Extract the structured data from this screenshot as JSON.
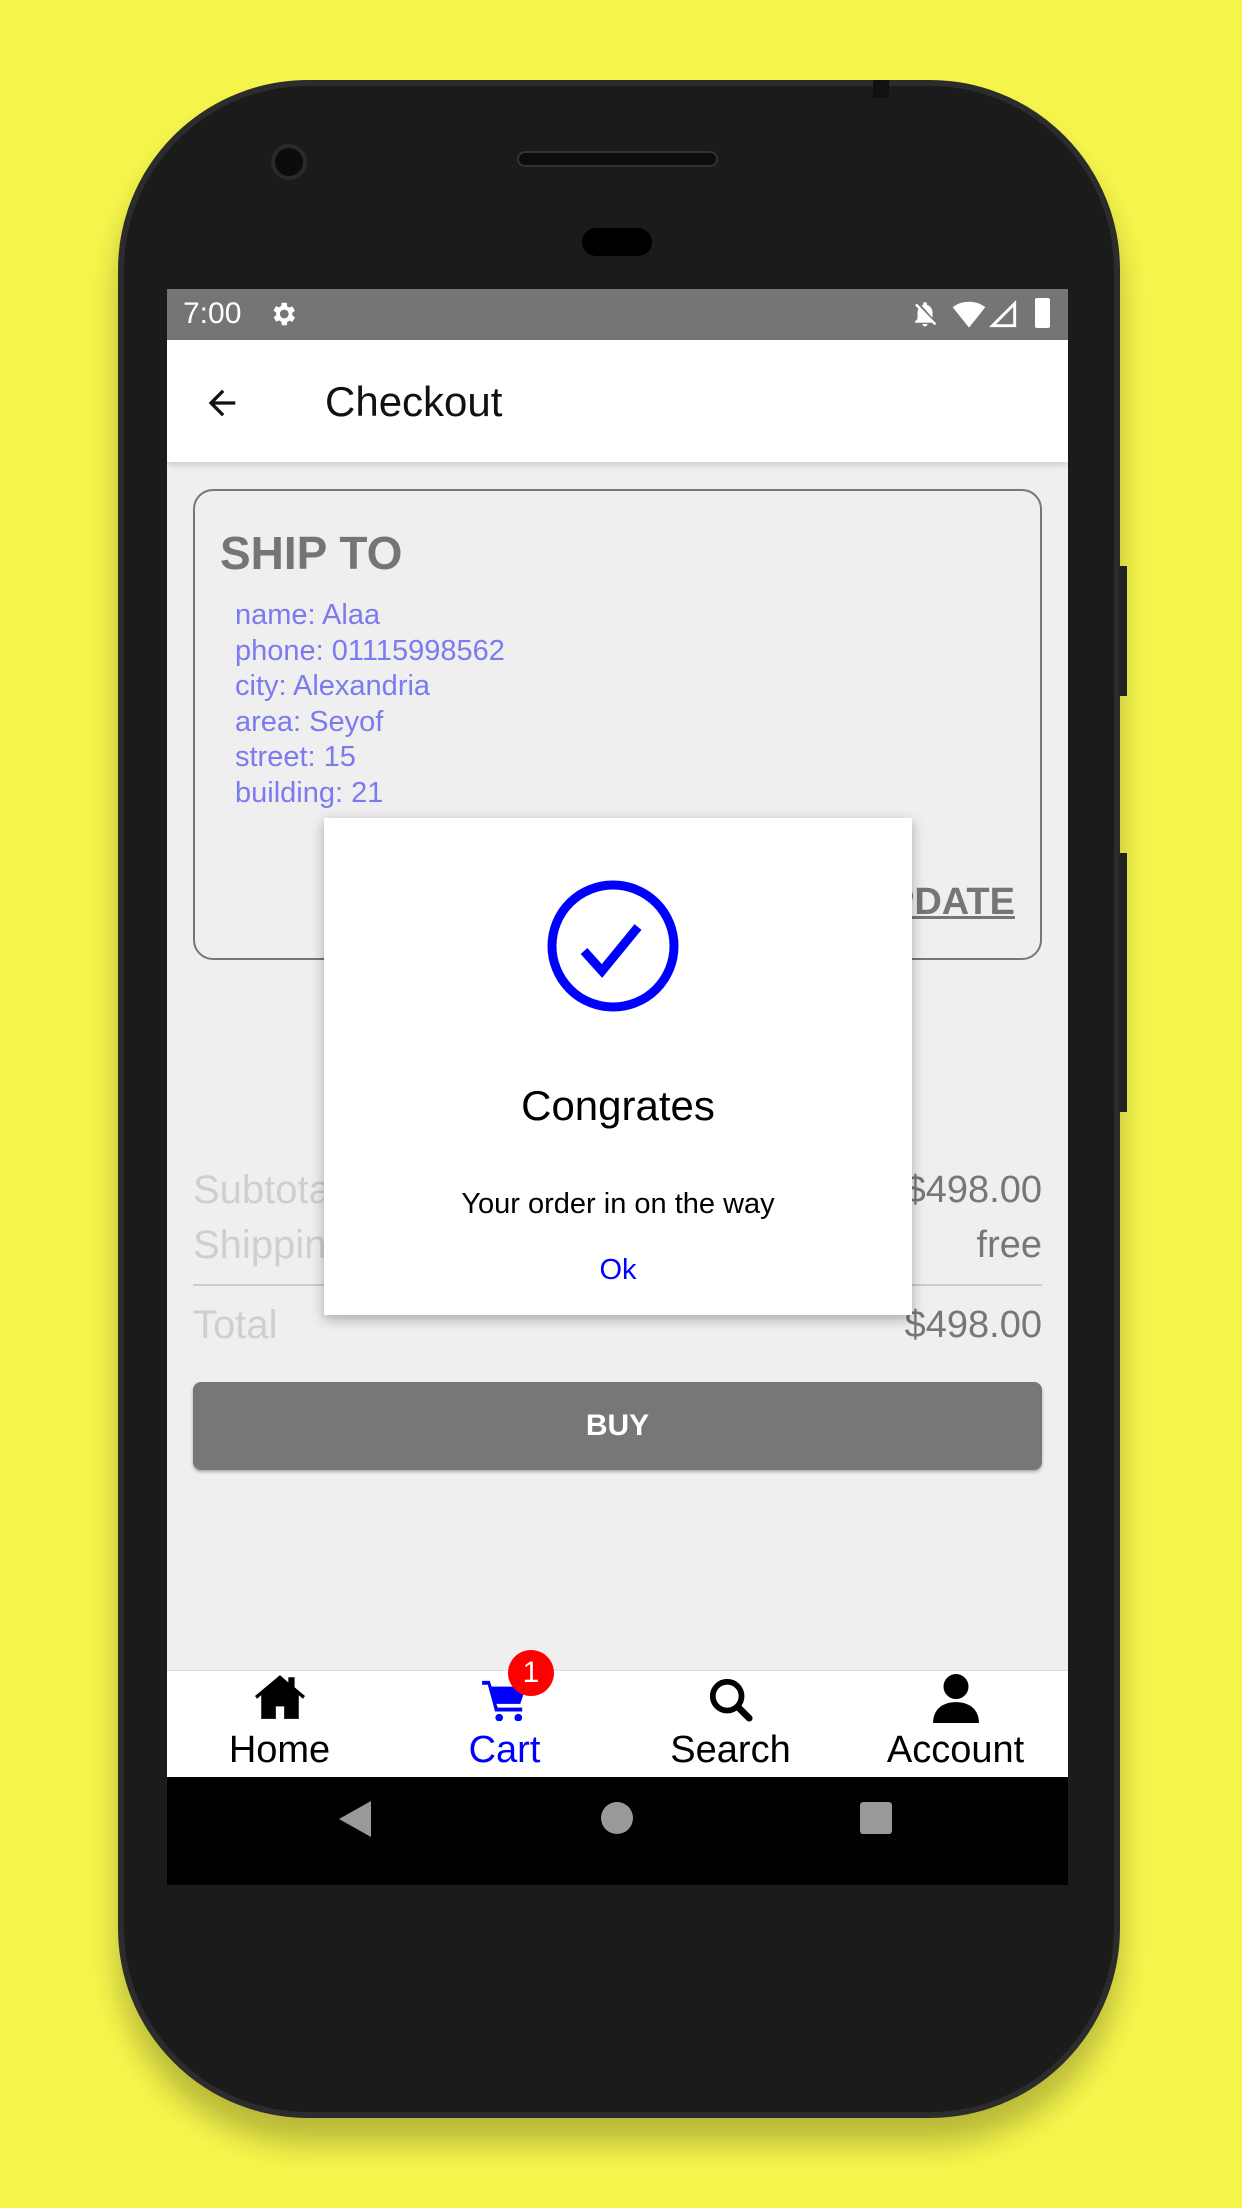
{
  "status_bar": {
    "time": "7:00"
  },
  "app_bar": {
    "title": "Checkout"
  },
  "ship_to": {
    "heading": "SHIP TO",
    "lines": [
      "name: Alaa",
      "phone: 01115998562",
      "city: Alexandria",
      "area: Seyof",
      "street: 15",
      "building: 21"
    ],
    "update_label": "UPDATE"
  },
  "summary": {
    "subtotal_label": "Subtotal",
    "subtotal_value": "$498.00",
    "shipping_label": "Shipping",
    "shipping_value": "free",
    "total_label": "Total",
    "total_value": "$498.00"
  },
  "buy_label": "BUY",
  "dialog": {
    "title": "Congrates",
    "message": "Your order in on the way",
    "ok_label": "Ok"
  },
  "bottom_nav": {
    "items": [
      {
        "label": "Home"
      },
      {
        "label": "Cart",
        "badge": "1"
      },
      {
        "label": "Search"
      },
      {
        "label": "Account"
      }
    ]
  },
  "colors": {
    "accent": "#0000ff",
    "badge": "#ff0000",
    "background": "#f5f54c"
  }
}
